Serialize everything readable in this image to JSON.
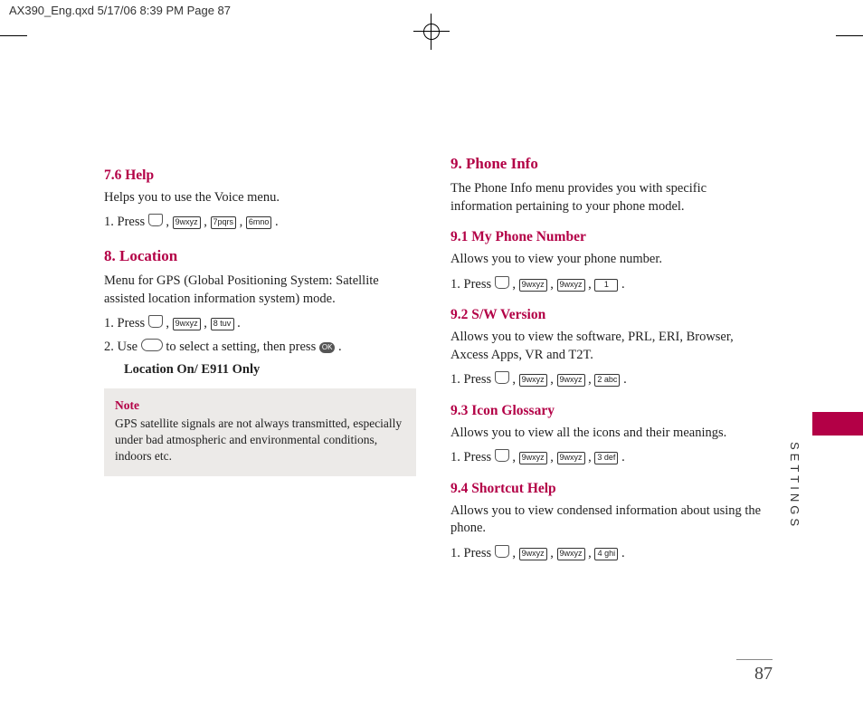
{
  "print_header": "AX390_Eng.qxd  5/17/06  8:39 PM  Page 87",
  "sections": {
    "s76_title": "7.6 Help",
    "s76_body": "Helps you to use the Voice menu.",
    "s76_step": "1. Press",
    "s76_keys": [
      "9wxyz",
      "7pqrs",
      "6mno"
    ],
    "s8_title": "8. Location",
    "s8_body": "Menu for GPS (Global Positioning System: Satellite assisted location information system) mode.",
    "s8_step1": "1. Press",
    "s8_keys1": [
      "9wxyz",
      "8 tuv"
    ],
    "s8_step2a": "2. Use",
    "s8_step2b": "to select a setting, then press",
    "s8_ok": "OK",
    "s8_opt": "Location On/ E911 Only",
    "note_title": "Note",
    "note_body": "GPS satellite signals are not always transmitted, especially under bad atmospheric and environmental conditions, indoors etc.",
    "s9_title": "9. Phone Info",
    "s9_body": "The Phone Info menu provides you with specific information pertaining to your phone model.",
    "s91_title": "9.1 My Phone Number",
    "s91_body": "Allows you to view your phone number.",
    "s91_step": "1. Press",
    "s91_keys": [
      "9wxyz",
      "9wxyz",
      "1"
    ],
    "s92_title": "9.2 S/W Version",
    "s92_body": "Allows you to view the software, PRL, ERI, Browser, Axcess Apps, VR and T2T.",
    "s92_step": "1. Press",
    "s92_keys": [
      "9wxyz",
      "9wxyz",
      "2 abc"
    ],
    "s93_title": "9.3 Icon Glossary",
    "s93_body": "Allows you to view all the icons and their meanings.",
    "s93_step": "1. Press",
    "s93_keys": [
      "9wxyz",
      "9wxyz",
      "3 def"
    ],
    "s94_title": "9.4 Shortcut Help",
    "s94_body": "Allows you to view condensed information about using the phone.",
    "s94_step": "1. Press",
    "s94_keys": [
      "9wxyz",
      "9wxyz",
      "4 ghi"
    ]
  },
  "side_label": "SETTINGS",
  "page_number": "87"
}
